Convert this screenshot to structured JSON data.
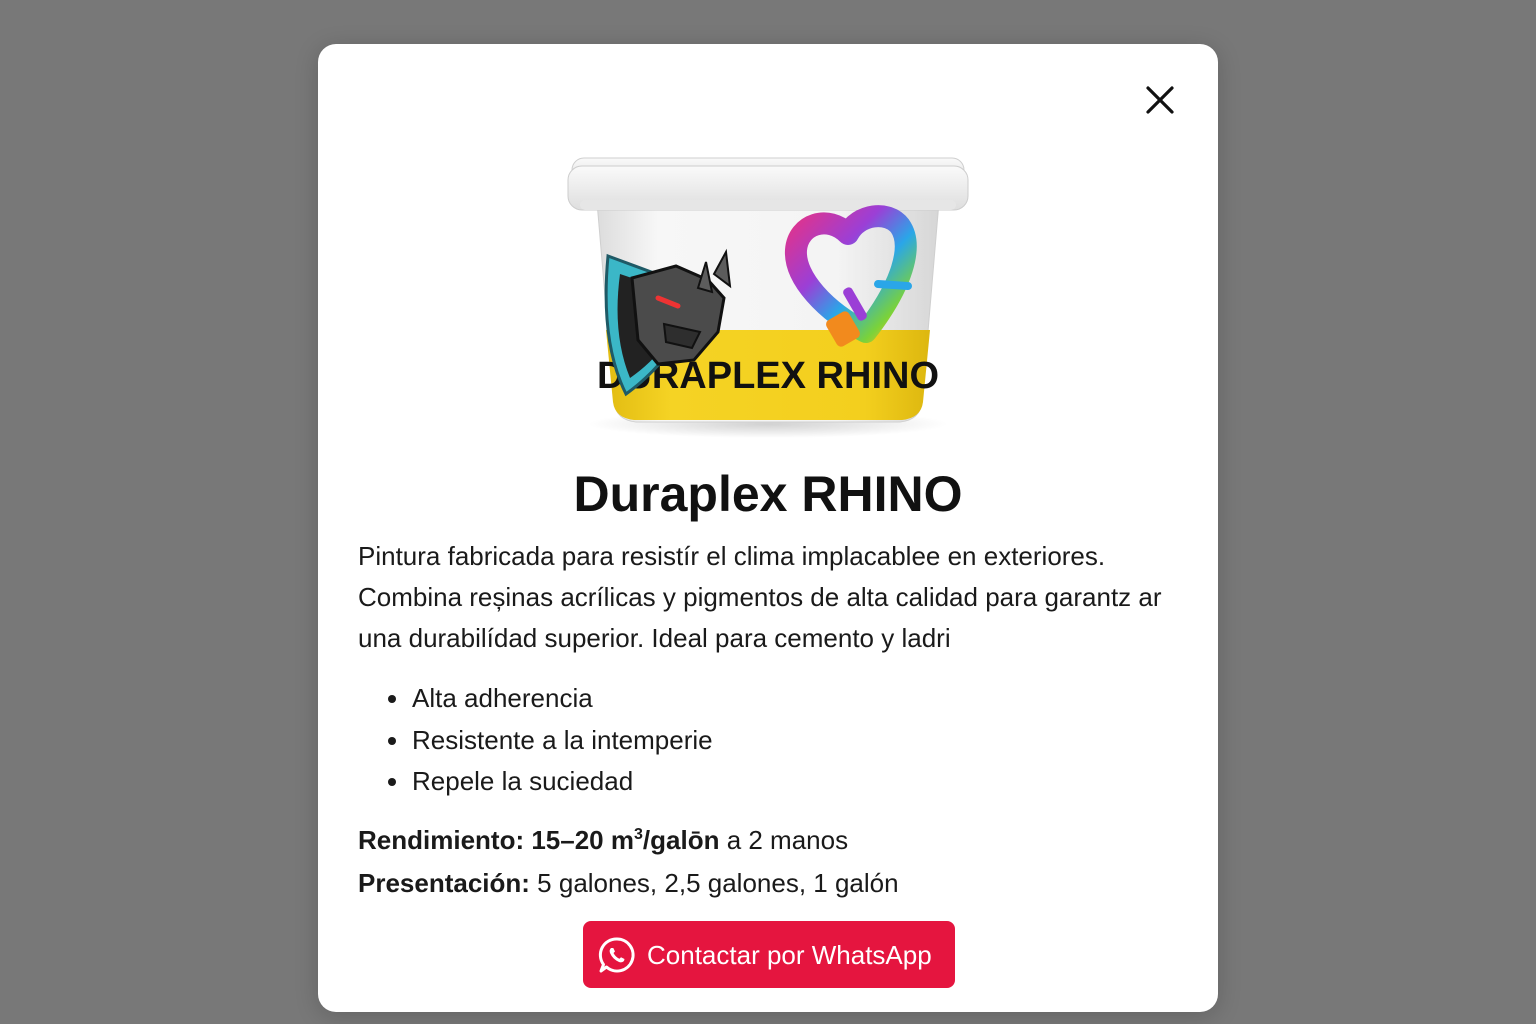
{
  "modal": {
    "close_icon": "close-icon",
    "product_image": {
      "icon": "paint-bucket-image",
      "bucket_label": "DURAPLEX RHINO",
      "logo_left": "rhino-shield-logo",
      "logo_right": "paint-heart-brush-logo",
      "colors": {
        "bucket": "#f4f4f4",
        "label_band": "#f2cf1d",
        "label_text": "#111111"
      }
    },
    "title": "Duraplex RHINO",
    "description": "Pintura fabricada para resistír el clima implacablee en exteriores. Combina reșinas acrílicas y pigmentos de alta calidad para garantz ar una durabilídad superior. Ideal para cemento y ladri",
    "features": [
      "Alta adherencia",
      "Resistente a la intemperie",
      "Repele la suciedad"
    ],
    "yield": {
      "label": "Rendimiento:",
      "value_prefix": "15–20 m",
      "value_sup": "3",
      "value_suffix": "/galōn",
      "extra": " a 2 manos"
    },
    "presentation": {
      "label": "Presentación:",
      "value": " 5 galones, 2,5 galones, 1 galón"
    },
    "whatsapp_button": {
      "label": "Contactar por WhatsApp",
      "icon": "whatsapp-icon",
      "color": "#e5153f"
    }
  },
  "colors": {
    "backdrop": "#787878",
    "modal_bg": "#ffffff"
  }
}
